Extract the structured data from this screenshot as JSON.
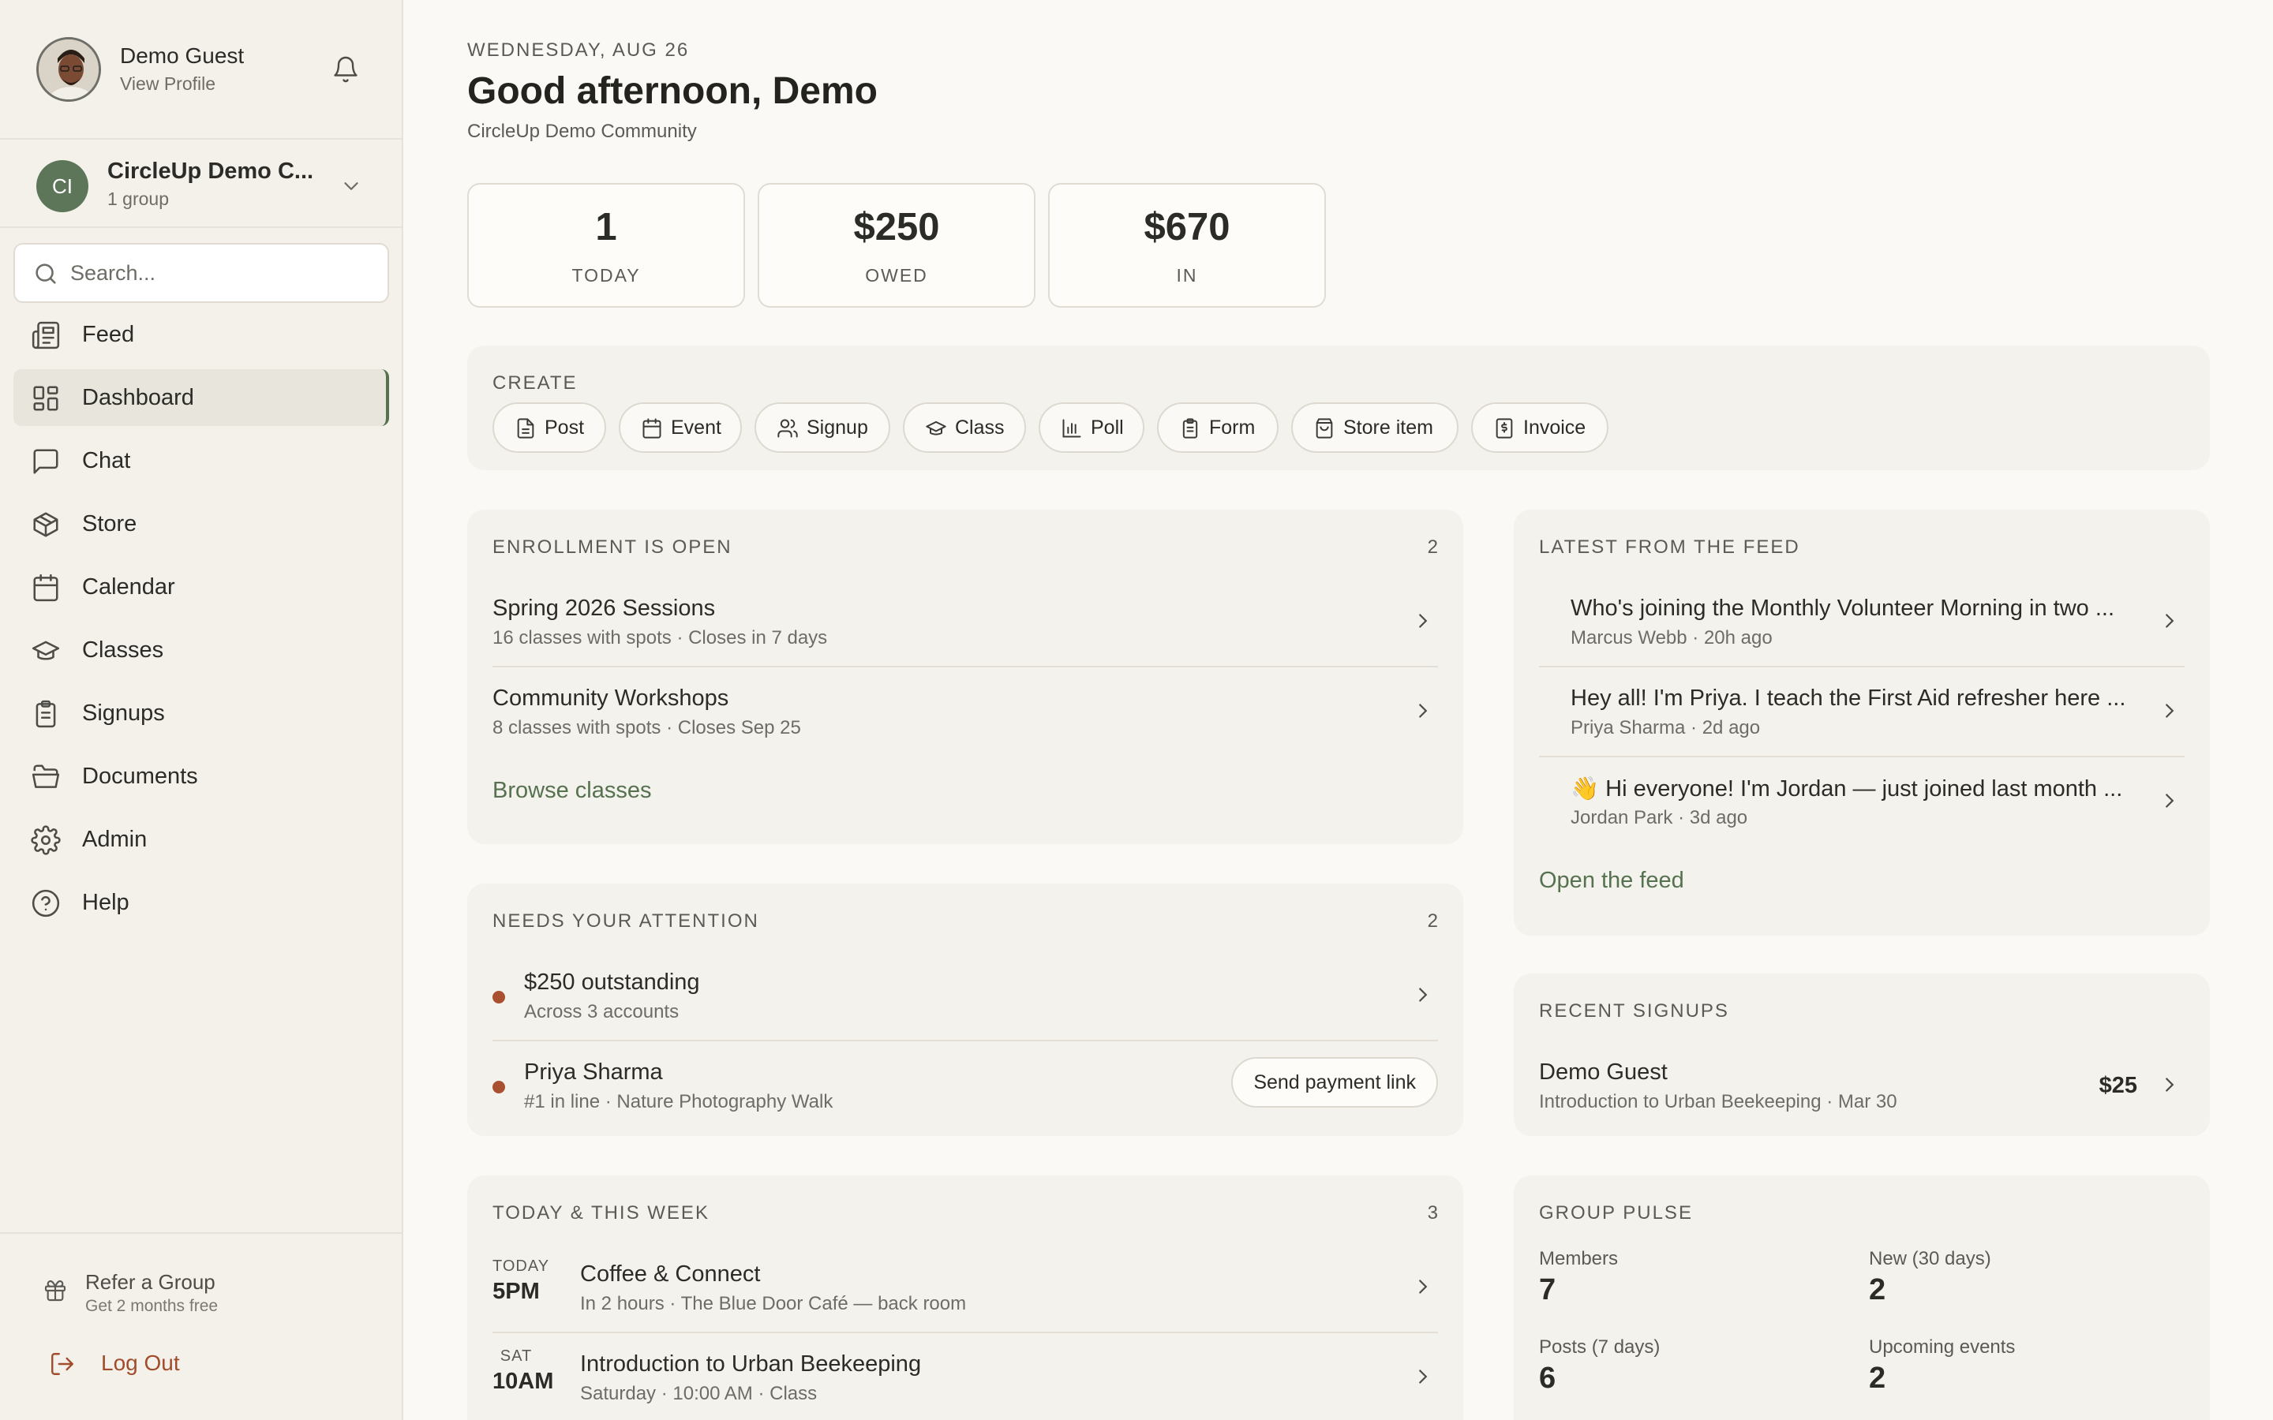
{
  "sidebar": {
    "profile": {
      "name": "Demo Guest",
      "subtitle": "View Profile"
    },
    "group": {
      "initials": "CI",
      "name": "CircleUp Demo C...",
      "subtitle": "1 group"
    },
    "search": {
      "placeholder": "Search..."
    },
    "nav": [
      {
        "label": "Feed",
        "icon": "newspaper-icon"
      },
      {
        "label": "Dashboard",
        "icon": "grid-icon",
        "active": true
      },
      {
        "label": "Chat",
        "icon": "chat-icon"
      },
      {
        "label": "Store",
        "icon": "box-icon"
      },
      {
        "label": "Calendar",
        "icon": "calendar-icon"
      },
      {
        "label": "Classes",
        "icon": "graduation-cap-icon"
      },
      {
        "label": "Signups",
        "icon": "clipboard-icon"
      },
      {
        "label": "Documents",
        "icon": "folder-icon"
      },
      {
        "label": "Admin",
        "icon": "gear-icon"
      },
      {
        "label": "Help",
        "icon": "help-icon"
      }
    ],
    "refer": {
      "title": "Refer a Group",
      "subtitle": "Get 2 months free"
    },
    "logout": "Log Out"
  },
  "header": {
    "date": "WEDNESDAY, AUG 26",
    "greeting": "Good afternoon, Demo",
    "community": "CircleUp Demo Community"
  },
  "stats": [
    {
      "value": "1",
      "label": "TODAY"
    },
    {
      "value": "$250",
      "label": "OWED"
    },
    {
      "value": "$670",
      "label": "IN"
    }
  ],
  "create": {
    "title": "CREATE",
    "buttons": [
      {
        "label": "Post",
        "icon": "document-icon"
      },
      {
        "label": "Event",
        "icon": "calendar-icon"
      },
      {
        "label": "Signup",
        "icon": "users-icon"
      },
      {
        "label": "Class",
        "icon": "graduation-cap-icon"
      },
      {
        "label": "Poll",
        "icon": "bar-chart-icon"
      },
      {
        "label": "Form",
        "icon": "clipboard-icon"
      },
      {
        "label": "Store item",
        "icon": "shopping-bag-icon"
      },
      {
        "label": "Invoice",
        "icon": "invoice-icon"
      }
    ]
  },
  "enrollment": {
    "title": "ENROLLMENT IS OPEN",
    "count": "2",
    "items": [
      {
        "title": "Spring 2026 Sessions",
        "subtitle": "16 classes with spots · Closes in 7 days"
      },
      {
        "title": "Community Workshops",
        "subtitle": "8 classes with spots · Closes Sep 25"
      }
    ],
    "action": "Browse classes"
  },
  "attention": {
    "title": "NEEDS YOUR ATTENTION",
    "count": "2",
    "items": [
      {
        "title": "$250 outstanding",
        "subtitle": "Across 3 accounts"
      },
      {
        "title": "Priya Sharma",
        "subtitle": "#1 in line · Nature Photography Walk",
        "action": "Send payment link"
      }
    ]
  },
  "week": {
    "title": "TODAY & THIS WEEK",
    "count": "3",
    "items": [
      {
        "day": "TODAY",
        "time": "5PM",
        "title": "Coffee & Connect",
        "subtitle": "In 2 hours · The Blue Door Café — back room"
      },
      {
        "day": "SAT",
        "time": "10AM",
        "title": "Introduction to Urban Beekeeping",
        "subtitle": "Saturday · 10:00 AM · Class"
      }
    ]
  },
  "feed": {
    "title": "LATEST FROM THE FEED",
    "items": [
      {
        "title": "Who's joining the Monthly Volunteer Morning in two ...",
        "subtitle": "Marcus Webb · 20h ago"
      },
      {
        "title": "Hey all! I'm Priya. I teach the First Aid refresher here ...",
        "subtitle": "Priya Sharma · 2d ago"
      },
      {
        "title": "👋  Hi everyone! I'm Jordan — just joined last month ...",
        "subtitle": "Jordan Park · 3d ago"
      }
    ],
    "action": "Open the feed"
  },
  "signups": {
    "title": "RECENT SIGNUPS",
    "items": [
      {
        "title": "Demo Guest",
        "subtitle": "Introduction to Urban Beekeeping · Mar 30",
        "amount": "$25"
      }
    ]
  },
  "pulse": {
    "title": "GROUP PULSE",
    "metrics": [
      {
        "label": "Members",
        "value": "7"
      },
      {
        "label": "New (30 days)",
        "value": "2"
      },
      {
        "label": "Posts (7 days)",
        "value": "6"
      },
      {
        "label": "Upcoming events",
        "value": "2"
      }
    ]
  },
  "colors": {
    "accent": "#56714f",
    "danger": "#a8502f",
    "background": "#fbf9f5",
    "card": "#f4f2ed"
  }
}
